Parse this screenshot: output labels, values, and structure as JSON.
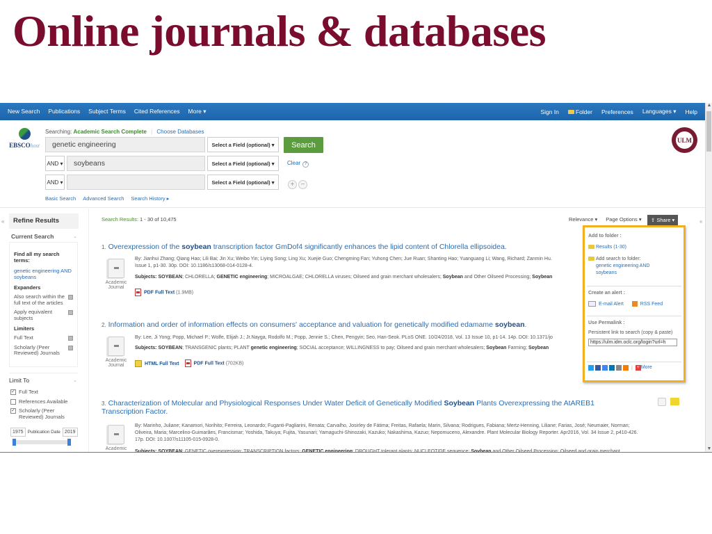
{
  "slide": {
    "title": "Online journals & databases"
  },
  "topnav": {
    "left": [
      "New Search",
      "Publications",
      "Subject Terms",
      "Cited References",
      "More ▾"
    ],
    "right": [
      "Sign In",
      "Folder",
      "Preferences",
      "Languages ▾",
      "Help"
    ]
  },
  "logo": {
    "brand": "EBSCO",
    "brand_suffix": "host"
  },
  "institution_logo": {
    "text": "ULM"
  },
  "searching": {
    "label": "Searching:",
    "database": "Academic Search Complete",
    "choose": "Choose Databases"
  },
  "search_rows": [
    {
      "bool": "",
      "value": "genetic engineering",
      "field": "Select a Field (optional) ▾"
    },
    {
      "bool": "AND ▾",
      "value": "soybeans",
      "field": "Select a Field (optional) ▾"
    },
    {
      "bool": "AND ▾",
      "value": "",
      "field": "Select a Field (optional) ▾"
    }
  ],
  "search_button": "Search",
  "clear": "Clear",
  "help_glyph": "?",
  "add_row": "+",
  "remove_row": "−",
  "search_links": [
    "Basic Search",
    "Advanced Search",
    "Search History ▸"
  ],
  "sidebar": {
    "collapse_glyph": "«",
    "refine_title": "Refine Results",
    "current_search": "Current Search",
    "find_all_label": "Find all my search terms:",
    "terms": "genetic engineering AND soybeans",
    "expanders_label": "Expanders",
    "expanders": [
      "Also search within the full text of the articles",
      "Apply equivalent subjects"
    ],
    "limiters_label": "Limiters",
    "limiters": [
      "Full Text",
      "Scholarly (Peer Reviewed) Journals"
    ],
    "limit_to": "Limit To",
    "limit_options": [
      {
        "label": "Full Text",
        "checked": true
      },
      {
        "label": "References Available",
        "checked": false
      },
      {
        "label": "Scholarly (Peer Reviewed) Journals",
        "checked": true
      }
    ],
    "pub_date": {
      "from": "1975",
      "label": "Publication Date",
      "to": "2019"
    }
  },
  "results_header": {
    "label": "Search Results:",
    "range": "1 - 30 of 10,475",
    "relevance": "Relevance ▾",
    "page_options": "Page Options ▾",
    "share": "Share ▾"
  },
  "results": [
    {
      "num": "1.",
      "title_pre": "Overexpression of the ",
      "title_bold": "soybean",
      "title_post": " transcription factor GmDof4 significantly enhances the lipid content of Chlorella ellipsoidea.",
      "type": "Academic Journal",
      "meta1": "By: Jianhui Zhang; Qiang Hao; Lili Bai; Jin Xu; Weibo Yin; Liying Song; Ling Xu; Xuejie Guo; Chengming Fan; Yuhong Chen; Jue Ruan; Shanting Hao; Yuanguang Li; Wang, Richard; Zanmin Hu.",
      "meta2": "Issue 1, p1-30. 30p. DOI: 10.1186/s13068-014-0128-4.",
      "subjects_label": "Subjects:",
      "subjects": "SOYBEAN; CHLORELLA; GENETIC engineering; MICROALGAE; CHLORELLA viruses; Oilseed and grain merchant wholesalers; Soybean and Other Oilseed Processing; Soybean",
      "fulltext": [
        {
          "kind": "pdf",
          "label": "PDF Full Text",
          "size": "(1.9MB)"
        }
      ]
    },
    {
      "num": "2.",
      "title_pre": "Information and order of information effects on consumers' acceptance and valuation for genetically modified edamame ",
      "title_bold": "soybean",
      "title_post": ".",
      "type": "Academic Journal",
      "meta1": "By: Lee, Ji Yong; Popp, Michael P.; Wolfe, Elijah J.; Jr.Nayga, Rodolfo M.; Popp, Jennie S.; Chen, Pengyin; Seo, Han-Seok. PLoS ONE. 10/24/2018, Vol. 13 Issue 10, p1-14. 14p. DOI: 10.1371/jo",
      "subjects_label": "Subjects:",
      "subjects": "SOYBEAN; TRANSGENIC plants; PLANT genetic engineering; SOCIAL acceptance; WILLINGNESS to pay; Oilseed and grain merchant wholesalers; Soybean Farming; Soybean",
      "fulltext": [
        {
          "kind": "html",
          "label": "HTML Full Text",
          "size": ""
        },
        {
          "kind": "pdf",
          "label": "PDF Full Text",
          "size": "(702KB)"
        }
      ]
    },
    {
      "num": "3.",
      "title_pre": "Characterization of Molecular and Physiological Responses Under Water Deficit of Genetically Modified ",
      "title_bold": "Soybean",
      "title_post": " Plants Overexpressing the AtAREB1",
      "title_line2": "Transcription Factor.",
      "type": "Academic",
      "meta1": "By: Marinho, Juliane; Kanamori, Norihito; Ferreira, Leonardo; Fuganti-Pagliarini, Renata; Carvalho, Josirley de Fátima; Freitas, Rafaela; Marin, Silvana; Rodrigues, Fabiana; Mertz-Henning, Liliane; Farias, José; Neumaier, Norman;",
      "meta2": "Oliveira, Maria; Marcelino-Guimarães, Francismar; Yoshida, Takuya; Fujita, Yasunari; Yamaguchi-Shinozaki, Kazuko; Nakashima, Kazuo; Nepomuceno, Alexandre. Plant Molecular Biology Reporter. Apr2016, Vol. 34 Issue 2, p410-426.",
      "meta3": "17p. DOI: 10.1007/s11105-015-0928-0.",
      "subjects_label": "Subjects:",
      "subjects": "SOYBEAN; GENETIC overexpression; TRANSCRIPTION factors; GENETIC engineering; DROUGHT tolerant plants; NUCLEOTIDE sequence; Soybean and Other Oilseed Processing; Oilseed and grain merchant"
    }
  ],
  "share_popup": {
    "add_to_folder": "Add to folder :",
    "results_link": "Results (1-30)",
    "add_search_label": "Add search to folder:",
    "add_search_terms": "genetic engineering AND soybeans",
    "create_alert": "Create an alert :",
    "email_alert": "E-mail Alert",
    "rss_feed": "RSS Feed",
    "permalink_label": "Use Permalink :",
    "permalink_desc": "Persistent link to search (copy & paste)",
    "permalink_value": "https://ulm.idm.oclc.org/login?url=h",
    "more": "More",
    "social": [
      {
        "name": "twitter",
        "color": "#1da1f2"
      },
      {
        "name": "facebook",
        "color": "#3b5998"
      },
      {
        "name": "google",
        "color": "#4285f4"
      },
      {
        "name": "linkedin",
        "color": "#0077b5"
      },
      {
        "name": "email",
        "color": "#888888"
      },
      {
        "name": "blogger",
        "color": "#f57d00"
      }
    ]
  }
}
